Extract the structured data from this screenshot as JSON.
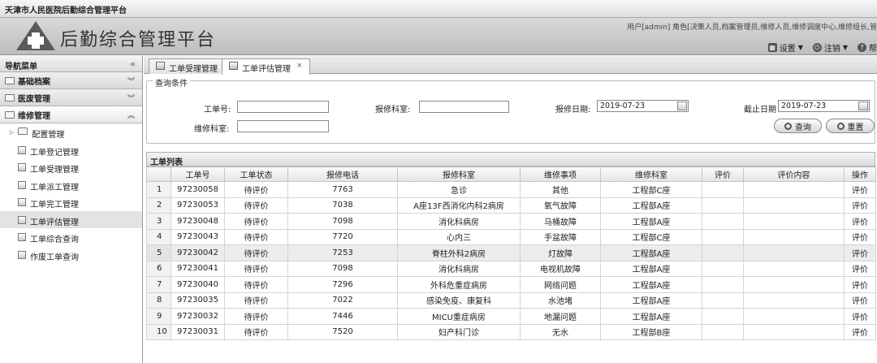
{
  "window": {
    "title": "天津市人民医院后勤综合管理平台"
  },
  "header": {
    "app_title": "后勤综合管理平台",
    "user_info": "用户[admin]  角色[决策人员,档案管理员,维修人员,维修调度中心,维修组长,管",
    "settings_label": "设置",
    "logout_label": "注销",
    "help_label": "帮"
  },
  "sidebar": {
    "title": "导航菜单",
    "sections": [
      {
        "label": "基础档案"
      },
      {
        "label": "医废管理"
      },
      {
        "label": "维修管理"
      }
    ],
    "items": [
      {
        "label": "配置管理"
      },
      {
        "label": "工单登记管理"
      },
      {
        "label": "工单受理管理"
      },
      {
        "label": "工单派工管理"
      },
      {
        "label": "工单完工管理"
      },
      {
        "label": "工单评估管理"
      },
      {
        "label": "工单综合查询"
      },
      {
        "label": "作废工单查询"
      }
    ]
  },
  "tabs": [
    {
      "label": "工单受理管理"
    },
    {
      "label": "工单评估管理",
      "close": "×"
    }
  ],
  "query": {
    "legend": "查询条件",
    "order_no_label": "工单号:",
    "order_no_value": "",
    "repair_dept_label": "报修科室:",
    "repair_dept_value": "",
    "repair_date_label": "报修日期:",
    "repair_date_value": "2019-07-23",
    "end_date_label": "截止日期",
    "end_date_value": "2019-07-23",
    "maint_dept_label": "维修科室:",
    "maint_dept_value": "",
    "search_label": "查询",
    "reset_label": "重置"
  },
  "list": {
    "title": "工单列表",
    "columns": [
      "",
      "工单号",
      "工单状态",
      "报修电话",
      "报修科室",
      "维修事项",
      "维修科室",
      "评价",
      "评价内容",
      "操作"
    ],
    "rows": [
      [
        "1",
        "97230058",
        "待评价",
        "7763",
        "急诊",
        "其他",
        "工程部C座",
        "",
        "",
        "评价"
      ],
      [
        "2",
        "97230053",
        "待评价",
        "7038",
        "A座13F西消化内科2病房",
        "氧气故障",
        "工程部A座",
        "",
        "",
        "评价"
      ],
      [
        "3",
        "97230048",
        "待评价",
        "7098",
        "消化科病房",
        "马桶故障",
        "工程部A座",
        "",
        "",
        "评价"
      ],
      [
        "4",
        "97230043",
        "待评价",
        "7720",
        "心内三",
        "手盆故障",
        "工程部C座",
        "",
        "",
        "评价"
      ],
      [
        "5",
        "97230042",
        "待评价",
        "7253",
        "脊柱外科2病房",
        "灯故障",
        "工程部A座",
        "",
        "",
        "评价"
      ],
      [
        "6",
        "97230041",
        "待评价",
        "7098",
        "消化科病房",
        "电视机故障",
        "工程部A座",
        "",
        "",
        "评价"
      ],
      [
        "7",
        "97230040",
        "待评价",
        "7296",
        "外科危重症病房",
        "网络问题",
        "工程部A座",
        "",
        "",
        "评价"
      ],
      [
        "8",
        "97230035",
        "待评价",
        "7022",
        "感染免疫、康复科",
        "水池堵",
        "工程部A座",
        "",
        "",
        "评价"
      ],
      [
        "9",
        "97230032",
        "待评价",
        "7446",
        "MICU重症病房",
        "地漏问题",
        "工程部A座",
        "",
        "",
        "评价"
      ],
      [
        "10",
        "97230031",
        "待评价",
        "7520",
        "妇产科门诊",
        "无水",
        "工程部B座",
        "",
        "",
        "评价"
      ]
    ]
  }
}
